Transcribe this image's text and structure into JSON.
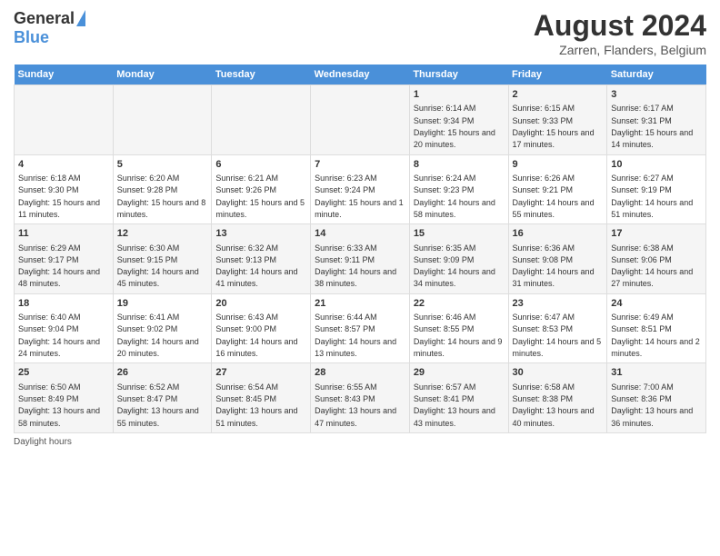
{
  "header": {
    "logo_general": "General",
    "logo_blue": "Blue",
    "title": "August 2024",
    "subtitle": "Zarren, Flanders, Belgium"
  },
  "days_of_week": [
    "Sunday",
    "Monday",
    "Tuesday",
    "Wednesday",
    "Thursday",
    "Friday",
    "Saturday"
  ],
  "weeks": [
    [
      {
        "day": "",
        "info": ""
      },
      {
        "day": "",
        "info": ""
      },
      {
        "day": "",
        "info": ""
      },
      {
        "day": "",
        "info": ""
      },
      {
        "day": "1",
        "info": "Sunrise: 6:14 AM\nSunset: 9:34 PM\nDaylight: 15 hours and 20 minutes."
      },
      {
        "day": "2",
        "info": "Sunrise: 6:15 AM\nSunset: 9:33 PM\nDaylight: 15 hours and 17 minutes."
      },
      {
        "day": "3",
        "info": "Sunrise: 6:17 AM\nSunset: 9:31 PM\nDaylight: 15 hours and 14 minutes."
      }
    ],
    [
      {
        "day": "4",
        "info": "Sunrise: 6:18 AM\nSunset: 9:30 PM\nDaylight: 15 hours and 11 minutes."
      },
      {
        "day": "5",
        "info": "Sunrise: 6:20 AM\nSunset: 9:28 PM\nDaylight: 15 hours and 8 minutes."
      },
      {
        "day": "6",
        "info": "Sunrise: 6:21 AM\nSunset: 9:26 PM\nDaylight: 15 hours and 5 minutes."
      },
      {
        "day": "7",
        "info": "Sunrise: 6:23 AM\nSunset: 9:24 PM\nDaylight: 15 hours and 1 minute."
      },
      {
        "day": "8",
        "info": "Sunrise: 6:24 AM\nSunset: 9:23 PM\nDaylight: 14 hours and 58 minutes."
      },
      {
        "day": "9",
        "info": "Sunrise: 6:26 AM\nSunset: 9:21 PM\nDaylight: 14 hours and 55 minutes."
      },
      {
        "day": "10",
        "info": "Sunrise: 6:27 AM\nSunset: 9:19 PM\nDaylight: 14 hours and 51 minutes."
      }
    ],
    [
      {
        "day": "11",
        "info": "Sunrise: 6:29 AM\nSunset: 9:17 PM\nDaylight: 14 hours and 48 minutes."
      },
      {
        "day": "12",
        "info": "Sunrise: 6:30 AM\nSunset: 9:15 PM\nDaylight: 14 hours and 45 minutes."
      },
      {
        "day": "13",
        "info": "Sunrise: 6:32 AM\nSunset: 9:13 PM\nDaylight: 14 hours and 41 minutes."
      },
      {
        "day": "14",
        "info": "Sunrise: 6:33 AM\nSunset: 9:11 PM\nDaylight: 14 hours and 38 minutes."
      },
      {
        "day": "15",
        "info": "Sunrise: 6:35 AM\nSunset: 9:09 PM\nDaylight: 14 hours and 34 minutes."
      },
      {
        "day": "16",
        "info": "Sunrise: 6:36 AM\nSunset: 9:08 PM\nDaylight: 14 hours and 31 minutes."
      },
      {
        "day": "17",
        "info": "Sunrise: 6:38 AM\nSunset: 9:06 PM\nDaylight: 14 hours and 27 minutes."
      }
    ],
    [
      {
        "day": "18",
        "info": "Sunrise: 6:40 AM\nSunset: 9:04 PM\nDaylight: 14 hours and 24 minutes."
      },
      {
        "day": "19",
        "info": "Sunrise: 6:41 AM\nSunset: 9:02 PM\nDaylight: 14 hours and 20 minutes."
      },
      {
        "day": "20",
        "info": "Sunrise: 6:43 AM\nSunset: 9:00 PM\nDaylight: 14 hours and 16 minutes."
      },
      {
        "day": "21",
        "info": "Sunrise: 6:44 AM\nSunset: 8:57 PM\nDaylight: 14 hours and 13 minutes."
      },
      {
        "day": "22",
        "info": "Sunrise: 6:46 AM\nSunset: 8:55 PM\nDaylight: 14 hours and 9 minutes."
      },
      {
        "day": "23",
        "info": "Sunrise: 6:47 AM\nSunset: 8:53 PM\nDaylight: 14 hours and 5 minutes."
      },
      {
        "day": "24",
        "info": "Sunrise: 6:49 AM\nSunset: 8:51 PM\nDaylight: 14 hours and 2 minutes."
      }
    ],
    [
      {
        "day": "25",
        "info": "Sunrise: 6:50 AM\nSunset: 8:49 PM\nDaylight: 13 hours and 58 minutes."
      },
      {
        "day": "26",
        "info": "Sunrise: 6:52 AM\nSunset: 8:47 PM\nDaylight: 13 hours and 55 minutes."
      },
      {
        "day": "27",
        "info": "Sunrise: 6:54 AM\nSunset: 8:45 PM\nDaylight: 13 hours and 51 minutes."
      },
      {
        "day": "28",
        "info": "Sunrise: 6:55 AM\nSunset: 8:43 PM\nDaylight: 13 hours and 47 minutes."
      },
      {
        "day": "29",
        "info": "Sunrise: 6:57 AM\nSunset: 8:41 PM\nDaylight: 13 hours and 43 minutes."
      },
      {
        "day": "30",
        "info": "Sunrise: 6:58 AM\nSunset: 8:38 PM\nDaylight: 13 hours and 40 minutes."
      },
      {
        "day": "31",
        "info": "Sunrise: 7:00 AM\nSunset: 8:36 PM\nDaylight: 13 hours and 36 minutes."
      }
    ]
  ],
  "footer": "Daylight hours"
}
